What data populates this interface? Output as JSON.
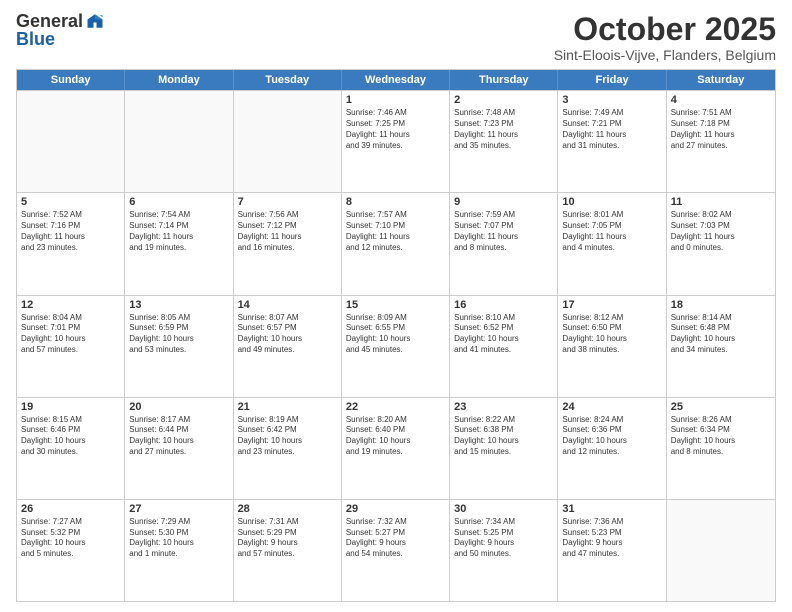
{
  "header": {
    "logo_general": "General",
    "logo_blue": "Blue",
    "month_title": "October 2025",
    "location": "Sint-Eloois-Vijve, Flanders, Belgium"
  },
  "days_of_week": [
    "Sunday",
    "Monday",
    "Tuesday",
    "Wednesday",
    "Thursday",
    "Friday",
    "Saturday"
  ],
  "weeks": [
    [
      {
        "day": "",
        "text": "",
        "empty": true
      },
      {
        "day": "",
        "text": "",
        "empty": true
      },
      {
        "day": "",
        "text": "",
        "empty": true
      },
      {
        "day": "1",
        "text": "Sunrise: 7:46 AM\nSunset: 7:25 PM\nDaylight: 11 hours\nand 39 minutes.",
        "empty": false
      },
      {
        "day": "2",
        "text": "Sunrise: 7:48 AM\nSunset: 7:23 PM\nDaylight: 11 hours\nand 35 minutes.",
        "empty": false
      },
      {
        "day": "3",
        "text": "Sunrise: 7:49 AM\nSunset: 7:21 PM\nDaylight: 11 hours\nand 31 minutes.",
        "empty": false
      },
      {
        "day": "4",
        "text": "Sunrise: 7:51 AM\nSunset: 7:18 PM\nDaylight: 11 hours\nand 27 minutes.",
        "empty": false
      }
    ],
    [
      {
        "day": "5",
        "text": "Sunrise: 7:52 AM\nSunset: 7:16 PM\nDaylight: 11 hours\nand 23 minutes.",
        "empty": false
      },
      {
        "day": "6",
        "text": "Sunrise: 7:54 AM\nSunset: 7:14 PM\nDaylight: 11 hours\nand 19 minutes.",
        "empty": false
      },
      {
        "day": "7",
        "text": "Sunrise: 7:56 AM\nSunset: 7:12 PM\nDaylight: 11 hours\nand 16 minutes.",
        "empty": false
      },
      {
        "day": "8",
        "text": "Sunrise: 7:57 AM\nSunset: 7:10 PM\nDaylight: 11 hours\nand 12 minutes.",
        "empty": false
      },
      {
        "day": "9",
        "text": "Sunrise: 7:59 AM\nSunset: 7:07 PM\nDaylight: 11 hours\nand 8 minutes.",
        "empty": false
      },
      {
        "day": "10",
        "text": "Sunrise: 8:01 AM\nSunset: 7:05 PM\nDaylight: 11 hours\nand 4 minutes.",
        "empty": false
      },
      {
        "day": "11",
        "text": "Sunrise: 8:02 AM\nSunset: 7:03 PM\nDaylight: 11 hours\nand 0 minutes.",
        "empty": false
      }
    ],
    [
      {
        "day": "12",
        "text": "Sunrise: 8:04 AM\nSunset: 7:01 PM\nDaylight: 10 hours\nand 57 minutes.",
        "empty": false
      },
      {
        "day": "13",
        "text": "Sunrise: 8:05 AM\nSunset: 6:59 PM\nDaylight: 10 hours\nand 53 minutes.",
        "empty": false
      },
      {
        "day": "14",
        "text": "Sunrise: 8:07 AM\nSunset: 6:57 PM\nDaylight: 10 hours\nand 49 minutes.",
        "empty": false
      },
      {
        "day": "15",
        "text": "Sunrise: 8:09 AM\nSunset: 6:55 PM\nDaylight: 10 hours\nand 45 minutes.",
        "empty": false
      },
      {
        "day": "16",
        "text": "Sunrise: 8:10 AM\nSunset: 6:52 PM\nDaylight: 10 hours\nand 41 minutes.",
        "empty": false
      },
      {
        "day": "17",
        "text": "Sunrise: 8:12 AM\nSunset: 6:50 PM\nDaylight: 10 hours\nand 38 minutes.",
        "empty": false
      },
      {
        "day": "18",
        "text": "Sunrise: 8:14 AM\nSunset: 6:48 PM\nDaylight: 10 hours\nand 34 minutes.",
        "empty": false
      }
    ],
    [
      {
        "day": "19",
        "text": "Sunrise: 8:15 AM\nSunset: 6:46 PM\nDaylight: 10 hours\nand 30 minutes.",
        "empty": false
      },
      {
        "day": "20",
        "text": "Sunrise: 8:17 AM\nSunset: 6:44 PM\nDaylight: 10 hours\nand 27 minutes.",
        "empty": false
      },
      {
        "day": "21",
        "text": "Sunrise: 8:19 AM\nSunset: 6:42 PM\nDaylight: 10 hours\nand 23 minutes.",
        "empty": false
      },
      {
        "day": "22",
        "text": "Sunrise: 8:20 AM\nSunset: 6:40 PM\nDaylight: 10 hours\nand 19 minutes.",
        "empty": false
      },
      {
        "day": "23",
        "text": "Sunrise: 8:22 AM\nSunset: 6:38 PM\nDaylight: 10 hours\nand 15 minutes.",
        "empty": false
      },
      {
        "day": "24",
        "text": "Sunrise: 8:24 AM\nSunset: 6:36 PM\nDaylight: 10 hours\nand 12 minutes.",
        "empty": false
      },
      {
        "day": "25",
        "text": "Sunrise: 8:26 AM\nSunset: 6:34 PM\nDaylight: 10 hours\nand 8 minutes.",
        "empty": false
      }
    ],
    [
      {
        "day": "26",
        "text": "Sunrise: 7:27 AM\nSunset: 5:32 PM\nDaylight: 10 hours\nand 5 minutes.",
        "empty": false
      },
      {
        "day": "27",
        "text": "Sunrise: 7:29 AM\nSunset: 5:30 PM\nDaylight: 10 hours\nand 1 minute.",
        "empty": false
      },
      {
        "day": "28",
        "text": "Sunrise: 7:31 AM\nSunset: 5:29 PM\nDaylight: 9 hours\nand 57 minutes.",
        "empty": false
      },
      {
        "day": "29",
        "text": "Sunrise: 7:32 AM\nSunset: 5:27 PM\nDaylight: 9 hours\nand 54 minutes.",
        "empty": false
      },
      {
        "day": "30",
        "text": "Sunrise: 7:34 AM\nSunset: 5:25 PM\nDaylight: 9 hours\nand 50 minutes.",
        "empty": false
      },
      {
        "day": "31",
        "text": "Sunrise: 7:36 AM\nSunset: 5:23 PM\nDaylight: 9 hours\nand 47 minutes.",
        "empty": false
      },
      {
        "day": "",
        "text": "",
        "empty": true
      }
    ]
  ]
}
